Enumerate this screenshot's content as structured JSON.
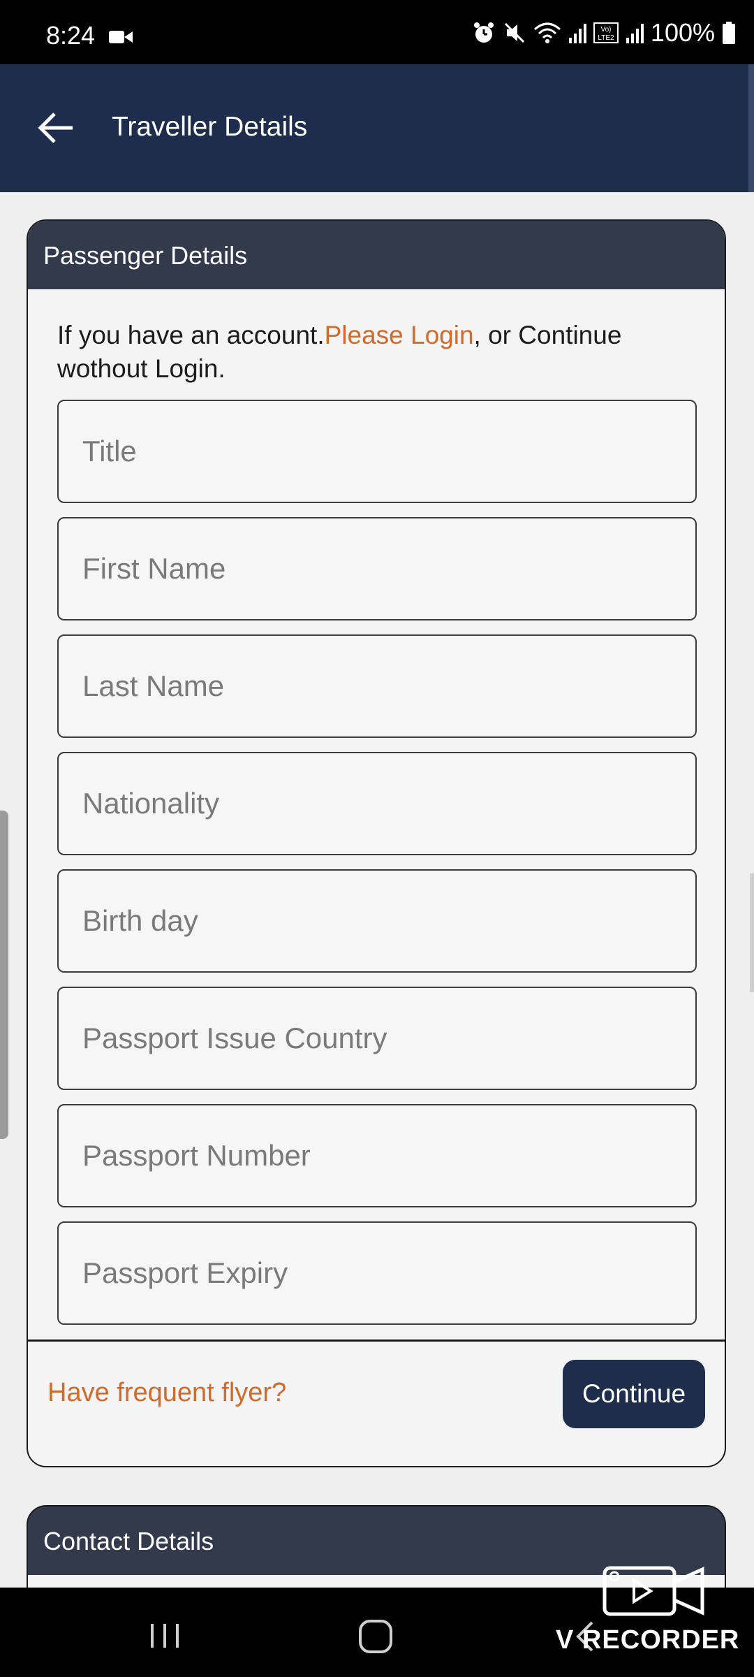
{
  "status_bar": {
    "time": "8:24",
    "battery": "100%",
    "icons": [
      "video-recording-icon",
      "alarm-icon",
      "mute-icon",
      "wifi-icon",
      "signal-icon",
      "volte-icon",
      "signal-icon",
      "battery-icon"
    ]
  },
  "app_bar": {
    "back_icon": "arrow-left-icon",
    "title": "Traveller Details",
    "background": "#1f2d4d"
  },
  "passenger": {
    "header": "Passenger Details",
    "intro_before": "If you have an account.",
    "login_link": "Please Login",
    "intro_after": ", or Continue wothout Login.",
    "fields": [
      {
        "placeholder": "Title"
      },
      {
        "placeholder": "First Name"
      },
      {
        "placeholder": "Last Name"
      },
      {
        "placeholder": "Nationality"
      },
      {
        "placeholder": "Birth day"
      },
      {
        "placeholder": "Passport Issue Country"
      },
      {
        "placeholder": "Passport Number"
      },
      {
        "placeholder": "Passport Expiry"
      }
    ],
    "frequent_flyer_link": "Have frequent flyer?",
    "continue_label": "Continue",
    "link_color": "#d06b2b"
  },
  "contact": {
    "header": "Contact Details"
  },
  "watermark": {
    "text": "V RECORDER"
  }
}
